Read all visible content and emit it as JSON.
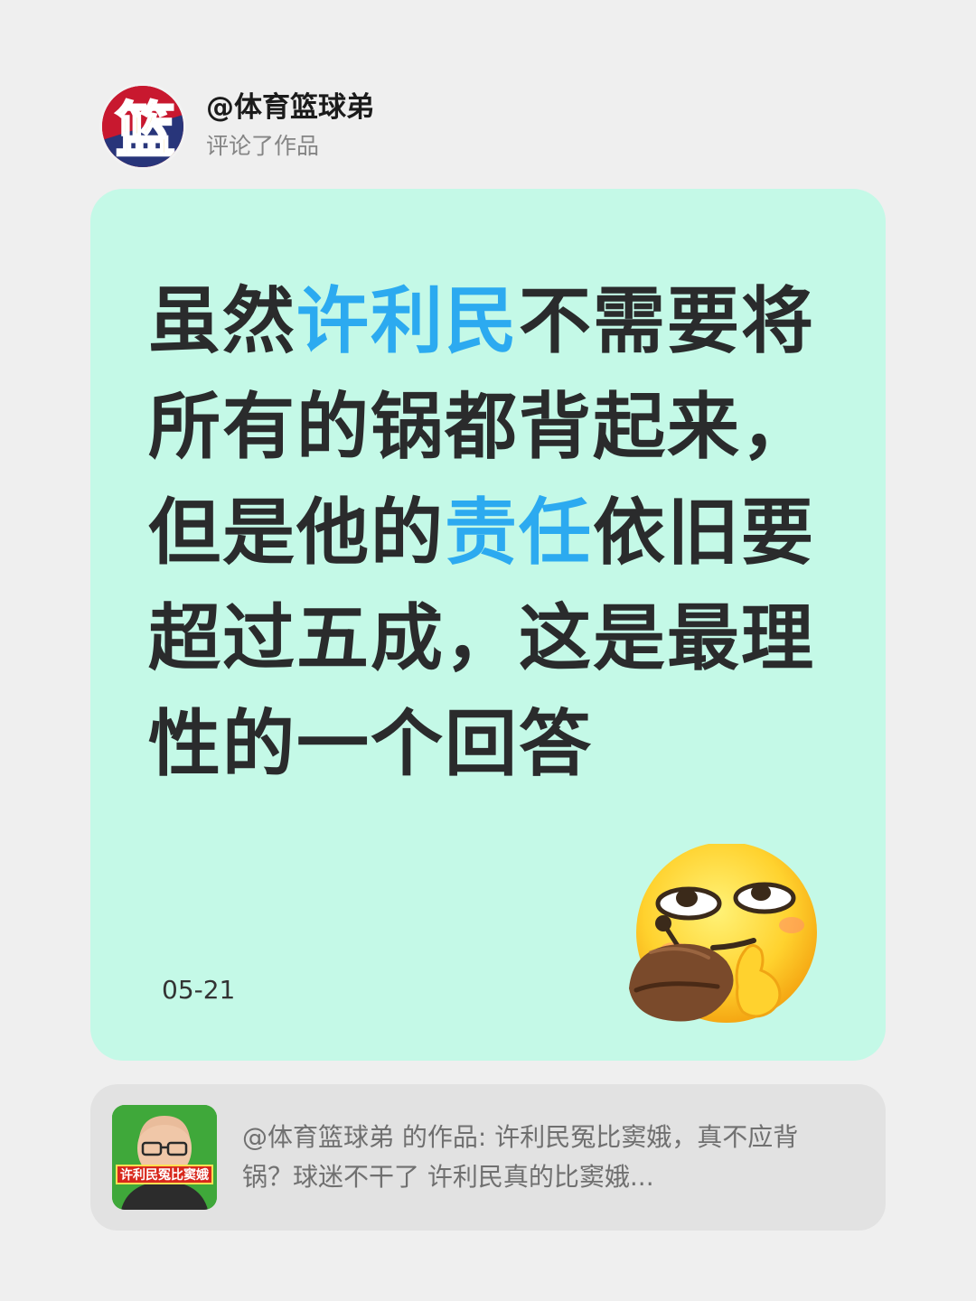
{
  "header": {
    "username": "@体育篮球弟",
    "action": "评论了作品",
    "avatar_glyph": "篮"
  },
  "comment": {
    "segments": [
      {
        "text": "虽然",
        "highlight": false
      },
      {
        "text": "许利民",
        "highlight": true
      },
      {
        "text": "不需要将所有的锅都背起来，但是他的",
        "highlight": false
      },
      {
        "text": "责任",
        "highlight": true
      },
      {
        "text": "依旧要超过五成，这是最理性的一个回答",
        "highlight": false
      }
    ],
    "date": "05-21",
    "emoji": "smirk-thinking-emoji"
  },
  "work": {
    "thumb_banner": "许利民冤比窦娥",
    "text": "@体育篮球弟 的作品: 许利民冤比窦娥，真不应背锅？球迷不干了 许利民真的比窦娥..."
  },
  "colors": {
    "page_bg": "#efefef",
    "card_bg": "#c4f9e7",
    "highlight": "#2caaf0",
    "text_dark": "#2a2b2c",
    "work_bg": "#e2e2e2"
  }
}
